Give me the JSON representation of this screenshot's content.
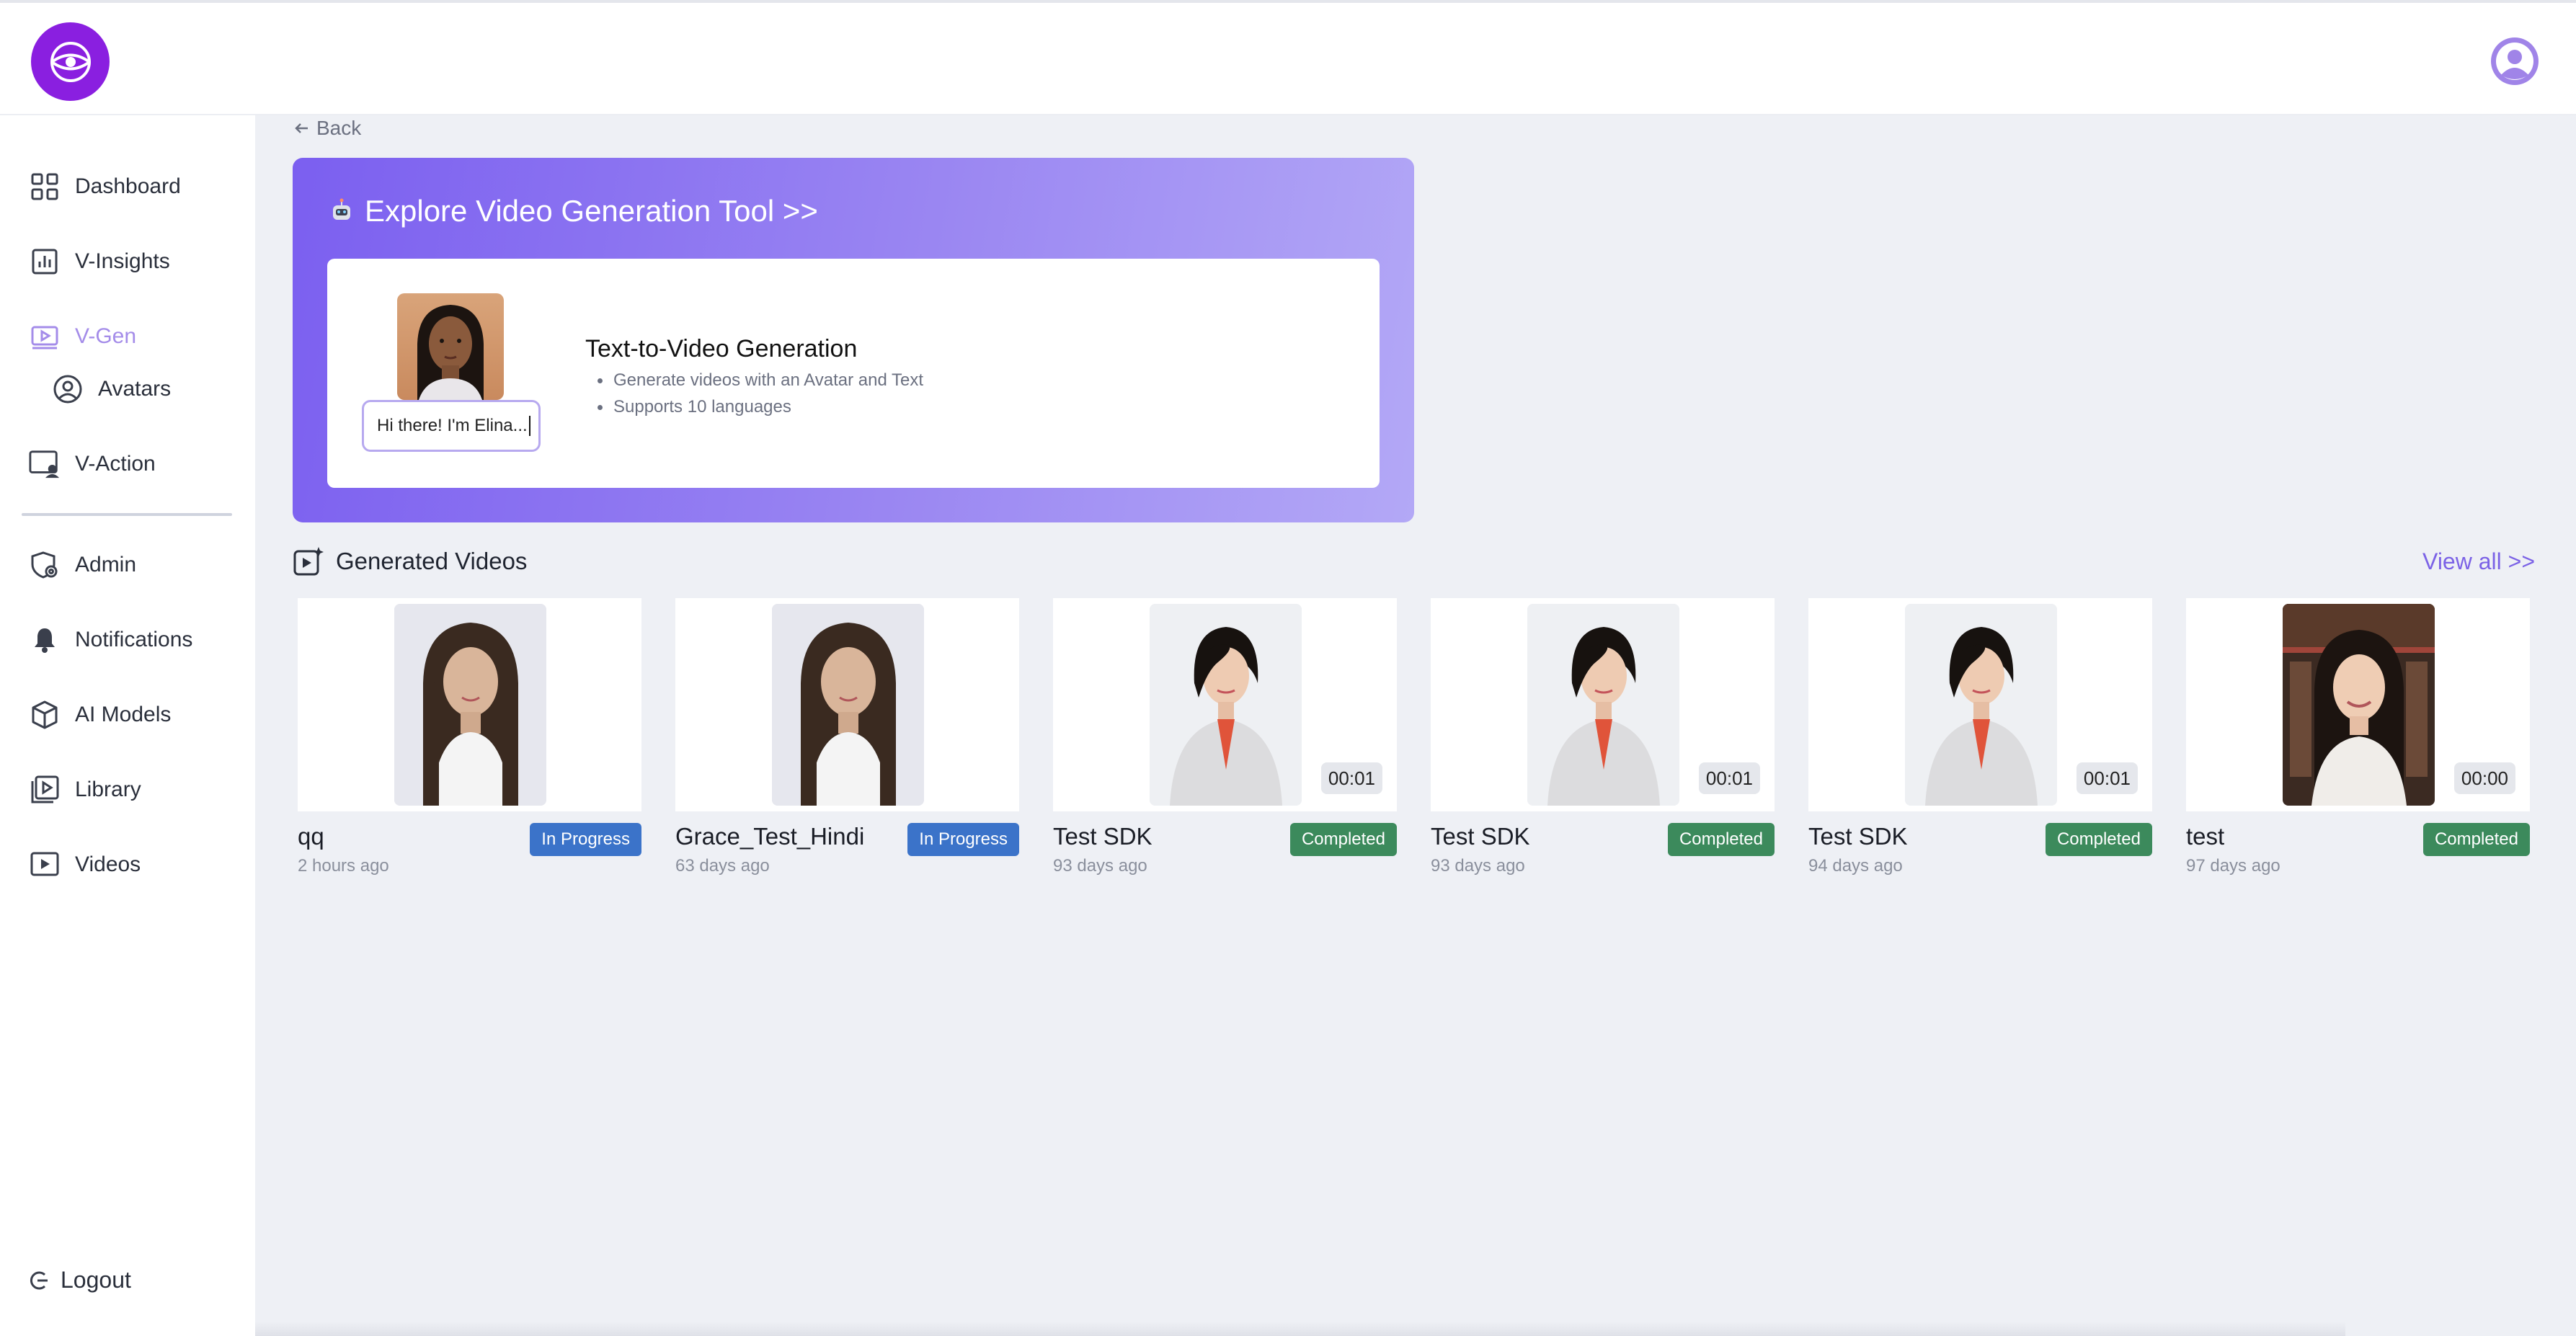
{
  "header": {
    "logo": "globe-eye-logo",
    "profile_icon": "user-profile-icon"
  },
  "sidebar": {
    "items": [
      {
        "label": "Dashboard",
        "icon": "grid-icon"
      },
      {
        "label": "V-Insights",
        "icon": "bar-chart-icon"
      },
      {
        "label": "V-Gen",
        "icon": "video-play-icon",
        "active": true
      },
      {
        "label": "Avatars",
        "icon": "user-circle-icon",
        "sub": true
      },
      {
        "label": "V-Action",
        "icon": "screen-user-icon"
      },
      {
        "label": "Admin",
        "icon": "shield-gear-icon"
      },
      {
        "label": "Notifications",
        "icon": "bell-icon"
      },
      {
        "label": "AI Models",
        "icon": "cube-icon"
      },
      {
        "label": "Library",
        "icon": "library-play-icon"
      },
      {
        "label": "Videos",
        "icon": "video-icon"
      }
    ],
    "logout": "Logout"
  },
  "main": {
    "back": "Back",
    "hero": {
      "title": "Explore Video Generation Tool >>",
      "speech": "Hi there! I'm Elina...",
      "feature_title": "Text-to-Video Generation",
      "features": [
        "Generate videos with an Avatar and Text",
        "Supports 10 languages"
      ]
    },
    "generated": {
      "title": "Generated Videos",
      "view_all": "View all >>",
      "videos": [
        {
          "name": "qq",
          "time": "2 hours ago",
          "status": "In Progress",
          "duration": ""
        },
        {
          "name": "Grace_Test_Hindi",
          "time": "63 days ago",
          "status": "In Progress",
          "duration": ""
        },
        {
          "name": "Test SDK",
          "time": "93 days ago",
          "status": "Completed",
          "duration": "00:01"
        },
        {
          "name": "Test SDK",
          "time": "93 days ago",
          "status": "Completed",
          "duration": "00:01"
        },
        {
          "name": "Test SDK",
          "time": "94 days ago",
          "status": "Completed",
          "duration": "00:01"
        },
        {
          "name": "test",
          "time": "97 days ago",
          "status": "Completed",
          "duration": "00:00"
        }
      ]
    }
  },
  "colors": {
    "brand": "#8a1fe0",
    "accent": "#7b62e6",
    "in_progress": "#3b73c9",
    "completed": "#3c8a5c"
  }
}
